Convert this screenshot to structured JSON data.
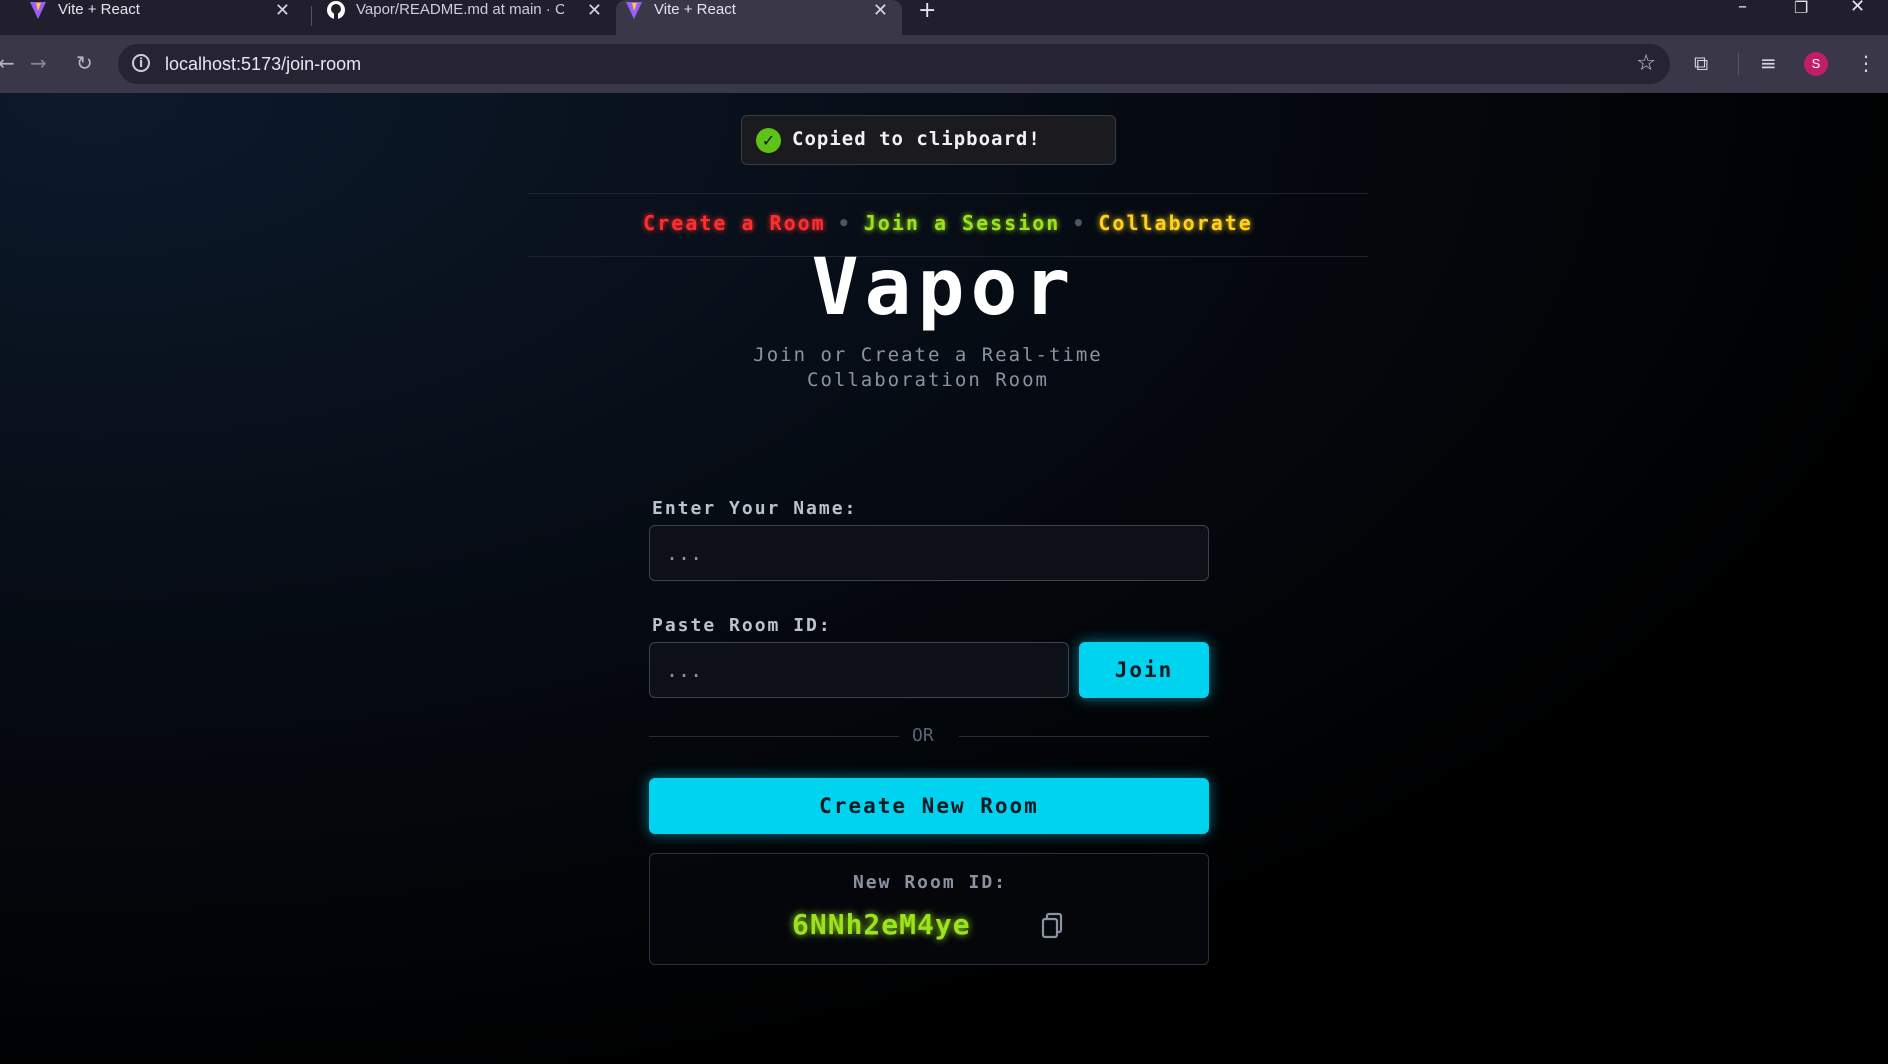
{
  "browser": {
    "tabs": [
      {
        "title": "Vite + React",
        "favicon": "vite-icon",
        "active": false
      },
      {
        "title": "Vapor/README.md at main · Ch",
        "favicon": "github-icon",
        "active": false
      },
      {
        "title": "Vite + React",
        "favicon": "vite-icon",
        "active": true
      }
    ],
    "url": "localhost:5173/join-room",
    "profile_initial": "S"
  },
  "toast": {
    "message": "Copied to clipboard!"
  },
  "tagline": {
    "create": "Create a Room",
    "join": "Join a Session",
    "collaborate": "Collaborate",
    "separator": "•"
  },
  "logo": "Vapor",
  "subtitle": {
    "line1": "Join or Create a Real-time",
    "line2": "Collaboration Room"
  },
  "form": {
    "name_label": "Enter Your Name:",
    "name_placeholder": "...",
    "room_label": "Paste Room ID:",
    "room_placeholder": "...",
    "join_label": "Join",
    "or_label": "OR",
    "create_label": "Create New Room"
  },
  "new_room": {
    "label": "New Room ID:",
    "id": "6NNh2eM4ye"
  },
  "colors": {
    "accent_cyan": "#00d3f0",
    "tag_red": "#ff2e2e",
    "tag_green": "#9be31a",
    "tag_yellow": "#ffd21a"
  }
}
